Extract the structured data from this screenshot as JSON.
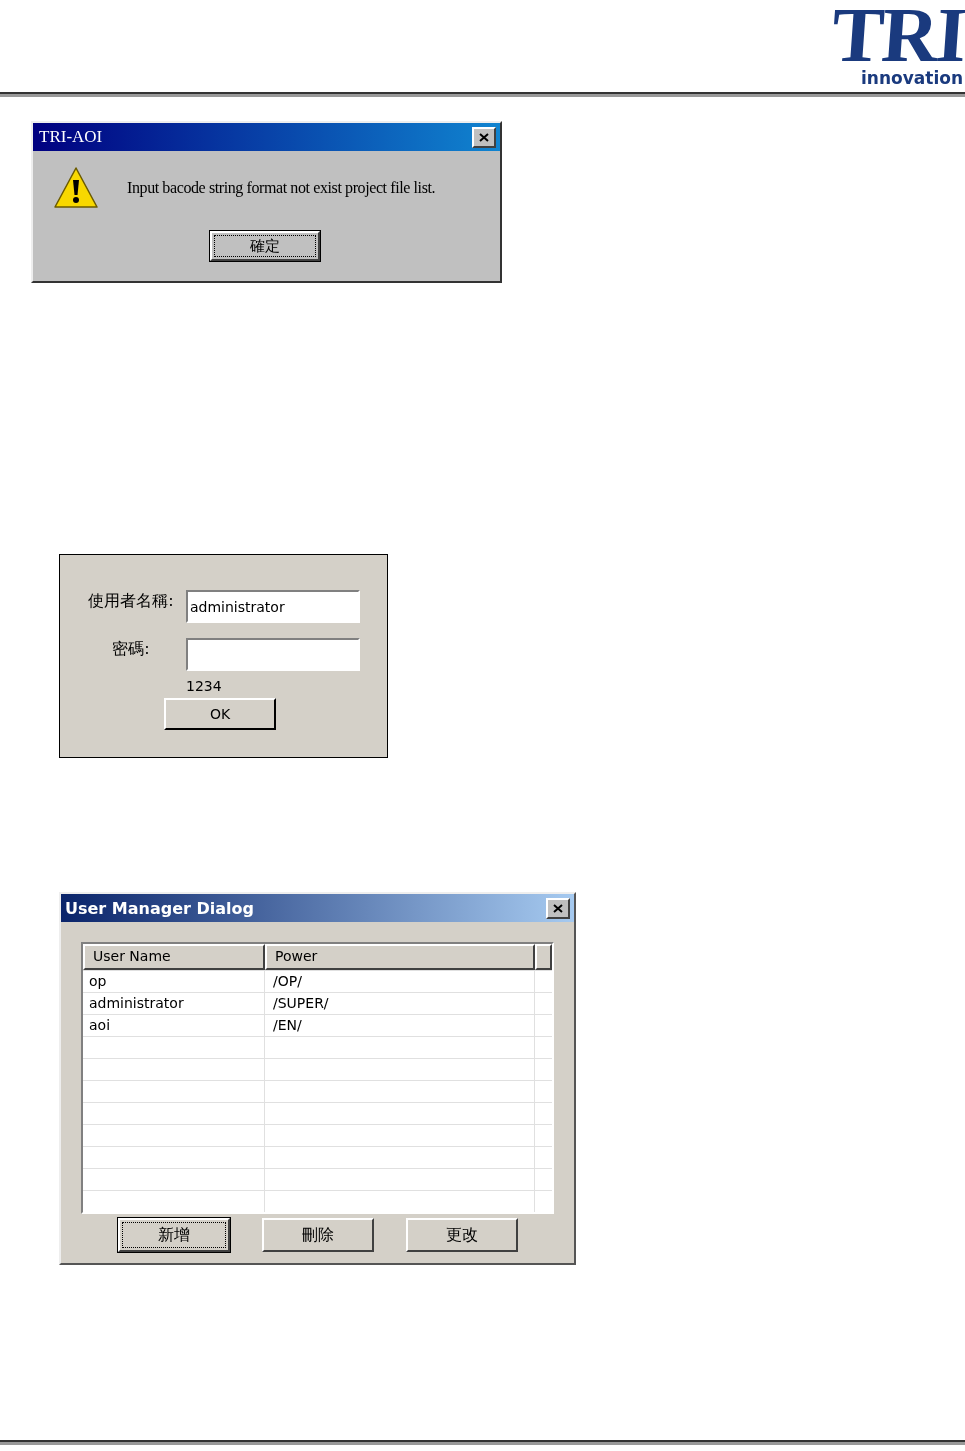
{
  "header": {
    "logo_mark": "TRI",
    "logo_text": "innovation"
  },
  "message_box": {
    "title": "TRI-AOI",
    "message": "Input bacode string format not exist project file list.",
    "buttons": [
      {
        "label": "確定",
        "focused": true
      }
    ]
  },
  "login_dialog": {
    "fields": [
      {
        "label": "使用者名稱:",
        "value": "administrator"
      },
      {
        "label": "密碼:"
      }
    ],
    "note": "1234",
    "buttons": [
      {
        "label": "OK",
        "focused": false
      }
    ]
  },
  "user_manager": {
    "title": "User Manager Dialog",
    "columns": [
      "User Name",
      "Power"
    ],
    "rows": [
      {
        "cells": [
          "op",
          "/OP/"
        ]
      },
      {
        "cells": [
          "administrator",
          "/SUPER/"
        ]
      },
      {
        "cells": [
          "aoi",
          "/EN/"
        ]
      }
    ],
    "buttons": [
      {
        "label": "新增",
        "focused": true
      },
      {
        "label": "刪除",
        "focused": false
      },
      {
        "label": "更改",
        "focused": false
      }
    ]
  }
}
